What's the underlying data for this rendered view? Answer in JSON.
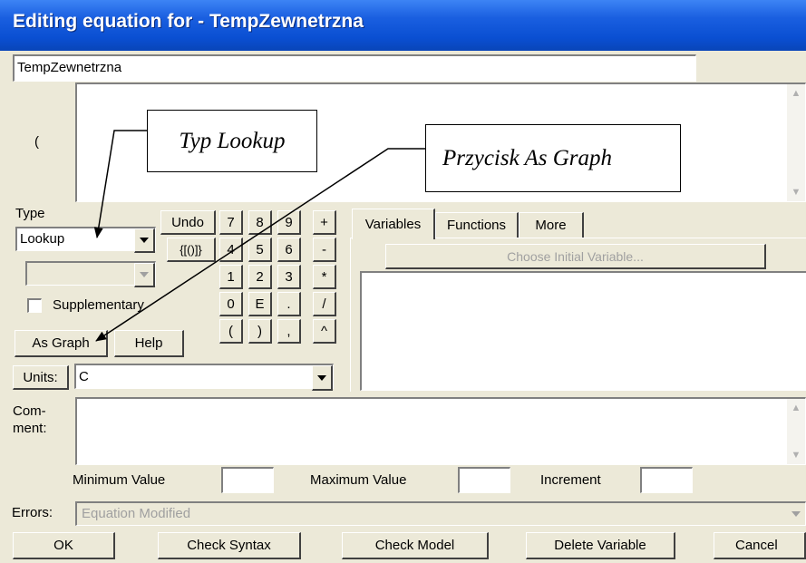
{
  "window": {
    "title": "Editing equation for - TempZewnetrzna"
  },
  "name_field": {
    "value": "TempZewnetrzna"
  },
  "equation": {
    "prefix": "(",
    "value": ""
  },
  "type": {
    "label": "Type",
    "selected": "Lookup",
    "sub_selected": ""
  },
  "supplementary": {
    "label": "Supplementary",
    "checked": false
  },
  "buttons": {
    "as_graph": "As Graph",
    "help": "Help",
    "undo": "Undo",
    "braces": "{[()]}"
  },
  "keypad": [
    [
      "7",
      "8",
      "9",
      "+"
    ],
    [
      "4",
      "5",
      "6",
      "-"
    ],
    [
      "1",
      "2",
      "3",
      "*"
    ],
    [
      "0",
      "E",
      ".",
      "/"
    ],
    [
      "(",
      ")",
      ",",
      "^"
    ]
  ],
  "units": {
    "label": "Units:",
    "value": "C"
  },
  "tabs": [
    "Variables",
    "Functions",
    "More"
  ],
  "choose_initial_variable": "Choose Initial Variable...",
  "comment": {
    "label_line1": "Com-",
    "label_line2": "ment:",
    "value": ""
  },
  "range": {
    "min_label": "Minimum Value",
    "max_label": "Maximum Value",
    "inc_label": "Increment"
  },
  "errors": {
    "label": "Errors:",
    "value": "Equation Modified"
  },
  "footer": {
    "ok": "OK",
    "check_syntax": "Check Syntax",
    "check_model": "Check Model",
    "delete_variable": "Delete Variable",
    "cancel": "Cancel"
  },
  "annotations": {
    "typ_lookup": "Typ Lookup",
    "przycisk_as_graph": "Przycisk As Graph"
  }
}
